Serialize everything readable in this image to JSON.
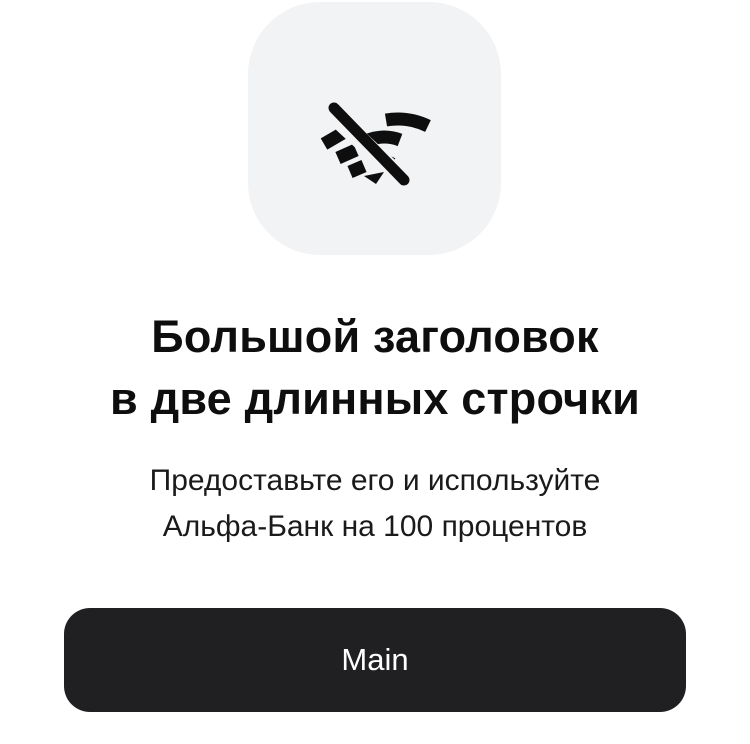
{
  "icon": {
    "name": "wifi-off-icon",
    "tile_color": "#f2f3f5",
    "glyph_color": "#0e0e0e"
  },
  "title": {
    "line1": "Большой заголовок",
    "line2": "в две длинных строчки"
  },
  "subtitle": {
    "line1": "Предоставьте его и используйте",
    "line2": "Альфа-Банк на 100 процентов"
  },
  "button": {
    "label": "Main",
    "background": "#202023",
    "text_color": "#ffffff"
  }
}
